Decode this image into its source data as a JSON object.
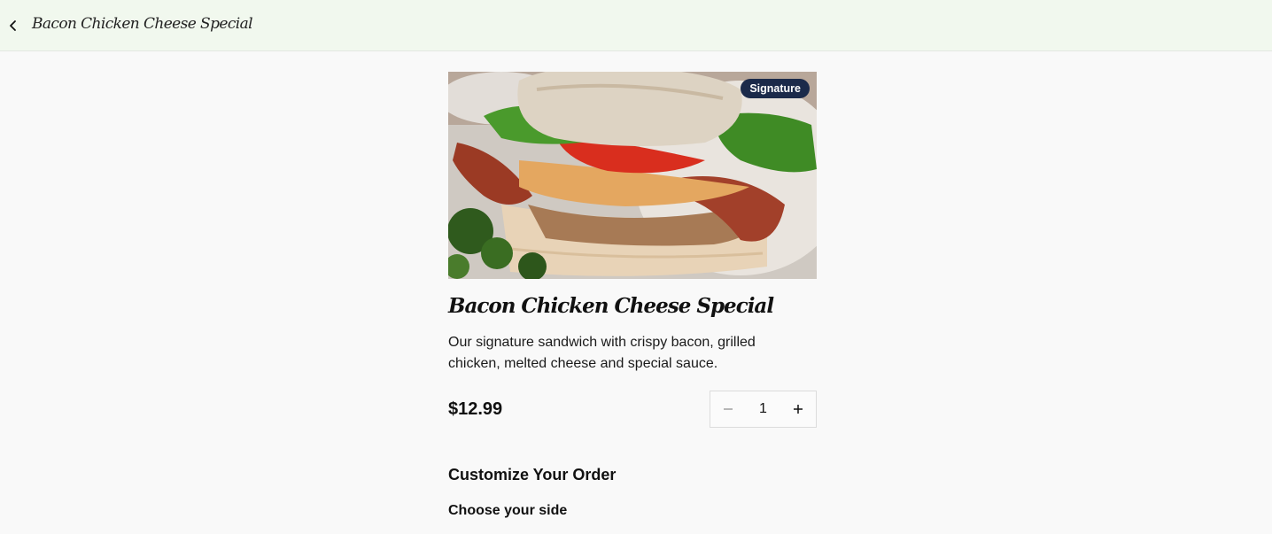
{
  "header": {
    "back_icon": "chevron-left-icon",
    "title": "Bacon Chicken Cheese Special"
  },
  "item": {
    "badge": "Signature",
    "name": "Bacon Chicken Cheese Special",
    "description": "Our signature sandwich with crispy bacon, grilled chicken, melted cheese and special sauce.",
    "price": "$12.99",
    "quantity": "1",
    "minus_icon": "minus-icon",
    "plus_icon": "plus-icon"
  },
  "customize": {
    "heading": "Customize Your Order",
    "side_heading": "Choose your side"
  },
  "colors": {
    "header_bg": "#f1f8ee",
    "page_bg": "#f9f9f9",
    "badge_bg": "#1b2a4a"
  }
}
